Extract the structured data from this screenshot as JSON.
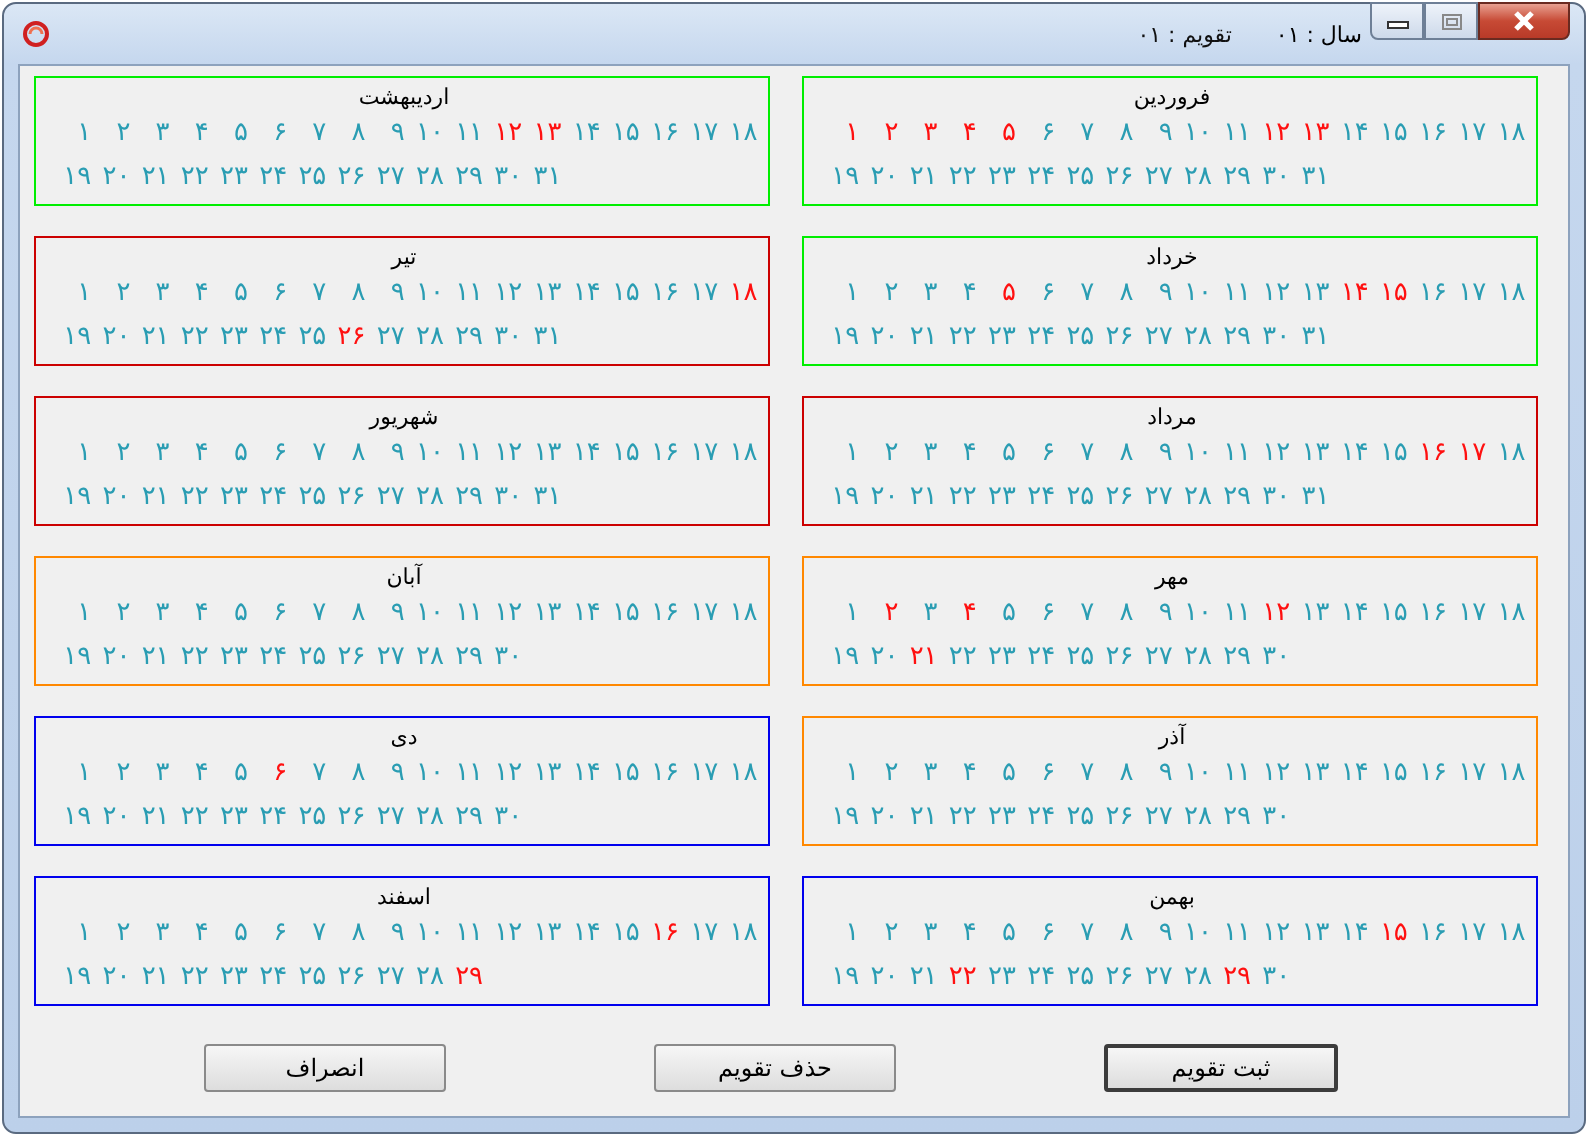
{
  "window": {
    "captions": [
      {
        "kind": "year",
        "text": "سال : ۰۱"
      },
      {
        "kind": "calendar",
        "text": "تقویم : ۰۱"
      }
    ]
  },
  "months": [
    {
      "name": "فروردین",
      "color": "#00ee00",
      "rows": [
        {
          "days": [
            {
              "d": "۱۸",
              "holiday": false
            },
            {
              "d": "۱۷",
              "holiday": false
            },
            {
              "d": "۱۶",
              "holiday": false
            },
            {
              "d": "۱۵",
              "holiday": false
            },
            {
              "d": "۱۴",
              "holiday": false
            },
            {
              "d": "۱۳",
              "holiday": true
            },
            {
              "d": "۱۲",
              "holiday": true
            },
            {
              "d": "۱۱",
              "holiday": false
            },
            {
              "d": "۱۰",
              "holiday": false
            },
            {
              "d": "۹",
              "holiday": false
            },
            {
              "d": "۸",
              "holiday": false
            },
            {
              "d": "۷",
              "holiday": false
            },
            {
              "d": "۶",
              "holiday": false
            },
            {
              "d": "۵",
              "holiday": true
            },
            {
              "d": "۴",
              "holiday": true
            },
            {
              "d": "۳",
              "holiday": true
            },
            {
              "d": "۲",
              "holiday": true
            },
            {
              "d": "۱",
              "holiday": true
            }
          ]
        },
        {
          "days": [
            {
              "d": "۳۱",
              "holiday": false
            },
            {
              "d": "۳۰",
              "holiday": false
            },
            {
              "d": "۲۹",
              "holiday": false
            },
            {
              "d": "۲۸",
              "holiday": false
            },
            {
              "d": "۲۷",
              "holiday": false
            },
            {
              "d": "۲۶",
              "holiday": false
            },
            {
              "d": "۲۵",
              "holiday": false
            },
            {
              "d": "۲۴",
              "holiday": false
            },
            {
              "d": "۲۳",
              "holiday": false
            },
            {
              "d": "۲۲",
              "holiday": false
            },
            {
              "d": "۲۱",
              "holiday": false
            },
            {
              "d": "۲۰",
              "holiday": false
            },
            {
              "d": "۱۹",
              "holiday": false
            }
          ]
        }
      ]
    },
    {
      "name": "اردیبهشت",
      "color": "#00ee00",
      "rows": [
        {
          "days": [
            {
              "d": "۱۸",
              "holiday": false
            },
            {
              "d": "۱۷",
              "holiday": false
            },
            {
              "d": "۱۶",
              "holiday": false
            },
            {
              "d": "۱۵",
              "holiday": false
            },
            {
              "d": "۱۴",
              "holiday": false
            },
            {
              "d": "۱۳",
              "holiday": true
            },
            {
              "d": "۱۲",
              "holiday": true
            },
            {
              "d": "۱۱",
              "holiday": false
            },
            {
              "d": "۱۰",
              "holiday": false
            },
            {
              "d": "۹",
              "holiday": false
            },
            {
              "d": "۸",
              "holiday": false
            },
            {
              "d": "۷",
              "holiday": false
            },
            {
              "d": "۶",
              "holiday": false
            },
            {
              "d": "۵",
              "holiday": false
            },
            {
              "d": "۴",
              "holiday": false
            },
            {
              "d": "۳",
              "holiday": false
            },
            {
              "d": "۲",
              "holiday": false
            },
            {
              "d": "۱",
              "holiday": false
            }
          ]
        },
        {
          "days": [
            {
              "d": "۳۱",
              "holiday": false
            },
            {
              "d": "۳۰",
              "holiday": false
            },
            {
              "d": "۲۹",
              "holiday": false
            },
            {
              "d": "۲۸",
              "holiday": false
            },
            {
              "d": "۲۷",
              "holiday": false
            },
            {
              "d": "۲۶",
              "holiday": false
            },
            {
              "d": "۲۵",
              "holiday": false
            },
            {
              "d": "۲۴",
              "holiday": false
            },
            {
              "d": "۲۳",
              "holiday": false
            },
            {
              "d": "۲۲",
              "holiday": false
            },
            {
              "d": "۲۱",
              "holiday": false
            },
            {
              "d": "۲۰",
              "holiday": false
            },
            {
              "d": "۱۹",
              "holiday": false
            }
          ]
        }
      ]
    },
    {
      "name": "خرداد",
      "color": "#00ee00",
      "rows": [
        {
          "days": [
            {
              "d": "۱۸",
              "holiday": false
            },
            {
              "d": "۱۷",
              "holiday": false
            },
            {
              "d": "۱۶",
              "holiday": false
            },
            {
              "d": "۱۵",
              "holiday": true
            },
            {
              "d": "۱۴",
              "holiday": true
            },
            {
              "d": "۱۳",
              "holiday": false
            },
            {
              "d": "۱۲",
              "holiday": false
            },
            {
              "d": "۱۱",
              "holiday": false
            },
            {
              "d": "۱۰",
              "holiday": false
            },
            {
              "d": "۹",
              "holiday": false
            },
            {
              "d": "۸",
              "holiday": false
            },
            {
              "d": "۷",
              "holiday": false
            },
            {
              "d": "۶",
              "holiday": false
            },
            {
              "d": "۵",
              "holiday": true
            },
            {
              "d": "۴",
              "holiday": false
            },
            {
              "d": "۳",
              "holiday": false
            },
            {
              "d": "۲",
              "holiday": false
            },
            {
              "d": "۱",
              "holiday": false
            }
          ]
        },
        {
          "days": [
            {
              "d": "۳۱",
              "holiday": false
            },
            {
              "d": "۳۰",
              "holiday": false
            },
            {
              "d": "۲۹",
              "holiday": false
            },
            {
              "d": "۲۸",
              "holiday": false
            },
            {
              "d": "۲۷",
              "holiday": false
            },
            {
              "d": "۲۶",
              "holiday": false
            },
            {
              "d": "۲۵",
              "holiday": false
            },
            {
              "d": "۲۴",
              "holiday": false
            },
            {
              "d": "۲۳",
              "holiday": false
            },
            {
              "d": "۲۲",
              "holiday": false
            },
            {
              "d": "۲۱",
              "holiday": false
            },
            {
              "d": "۲۰",
              "holiday": false
            },
            {
              "d": "۱۹",
              "holiday": false
            }
          ]
        }
      ]
    },
    {
      "name": "تیر",
      "color": "#cc0000",
      "rows": [
        {
          "days": [
            {
              "d": "۱۸",
              "holiday": true
            },
            {
              "d": "۱۷",
              "holiday": false
            },
            {
              "d": "۱۶",
              "holiday": false
            },
            {
              "d": "۱۵",
              "holiday": false
            },
            {
              "d": "۱۴",
              "holiday": false
            },
            {
              "d": "۱۳",
              "holiday": false
            },
            {
              "d": "۱۲",
              "holiday": false
            },
            {
              "d": "۱۱",
              "holiday": false
            },
            {
              "d": "۱۰",
              "holiday": false
            },
            {
              "d": "۹",
              "holiday": false
            },
            {
              "d": "۸",
              "holiday": false
            },
            {
              "d": "۷",
              "holiday": false
            },
            {
              "d": "۶",
              "holiday": false
            },
            {
              "d": "۵",
              "holiday": false
            },
            {
              "d": "۴",
              "holiday": false
            },
            {
              "d": "۳",
              "holiday": false
            },
            {
              "d": "۲",
              "holiday": false
            },
            {
              "d": "۱",
              "holiday": false
            }
          ]
        },
        {
          "days": [
            {
              "d": "۳۱",
              "holiday": false
            },
            {
              "d": "۳۰",
              "holiday": false
            },
            {
              "d": "۲۹",
              "holiday": false
            },
            {
              "d": "۲۸",
              "holiday": false
            },
            {
              "d": "۲۷",
              "holiday": false
            },
            {
              "d": "۲۶",
              "holiday": true
            },
            {
              "d": "۲۵",
              "holiday": false
            },
            {
              "d": "۲۴",
              "holiday": false
            },
            {
              "d": "۲۳",
              "holiday": false
            },
            {
              "d": "۲۲",
              "holiday": false
            },
            {
              "d": "۲۱",
              "holiday": false
            },
            {
              "d": "۲۰",
              "holiday": false
            },
            {
              "d": "۱۹",
              "holiday": false
            }
          ]
        }
      ]
    },
    {
      "name": "مرداد",
      "color": "#cc0000",
      "rows": [
        {
          "days": [
            {
              "d": "۱۸",
              "holiday": false
            },
            {
              "d": "۱۷",
              "holiday": true
            },
            {
              "d": "۱۶",
              "holiday": true
            },
            {
              "d": "۱۵",
              "holiday": false
            },
            {
              "d": "۱۴",
              "holiday": false
            },
            {
              "d": "۱۳",
              "holiday": false
            },
            {
              "d": "۱۲",
              "holiday": false
            },
            {
              "d": "۱۱",
              "holiday": false
            },
            {
              "d": "۱۰",
              "holiday": false
            },
            {
              "d": "۹",
              "holiday": false
            },
            {
              "d": "۸",
              "holiday": false
            },
            {
              "d": "۷",
              "holiday": false
            },
            {
              "d": "۶",
              "holiday": false
            },
            {
              "d": "۵",
              "holiday": false
            },
            {
              "d": "۴",
              "holiday": false
            },
            {
              "d": "۳",
              "holiday": false
            },
            {
              "d": "۲",
              "holiday": false
            },
            {
              "d": "۱",
              "holiday": false
            }
          ]
        },
        {
          "days": [
            {
              "d": "۳۱",
              "holiday": false
            },
            {
              "d": "۳۰",
              "holiday": false
            },
            {
              "d": "۲۹",
              "holiday": false
            },
            {
              "d": "۲۸",
              "holiday": false
            },
            {
              "d": "۲۷",
              "holiday": false
            },
            {
              "d": "۲۶",
              "holiday": false
            },
            {
              "d": "۲۵",
              "holiday": false
            },
            {
              "d": "۲۴",
              "holiday": false
            },
            {
              "d": "۲۳",
              "holiday": false
            },
            {
              "d": "۲۲",
              "holiday": false
            },
            {
              "d": "۲۱",
              "holiday": false
            },
            {
              "d": "۲۰",
              "holiday": false
            },
            {
              "d": "۱۹",
              "holiday": false
            }
          ]
        }
      ]
    },
    {
      "name": "شهریور",
      "color": "#cc0000",
      "rows": [
        {
          "days": [
            {
              "d": "۱۸",
              "holiday": false
            },
            {
              "d": "۱۷",
              "holiday": false
            },
            {
              "d": "۱۶",
              "holiday": false
            },
            {
              "d": "۱۵",
              "holiday": false
            },
            {
              "d": "۱۴",
              "holiday": false
            },
            {
              "d": "۱۳",
              "holiday": false
            },
            {
              "d": "۱۲",
              "holiday": false
            },
            {
              "d": "۱۱",
              "holiday": false
            },
            {
              "d": "۱۰",
              "holiday": false
            },
            {
              "d": "۹",
              "holiday": false
            },
            {
              "d": "۸",
              "holiday": false
            },
            {
              "d": "۷",
              "holiday": false
            },
            {
              "d": "۶",
              "holiday": false
            },
            {
              "d": "۵",
              "holiday": false
            },
            {
              "d": "۴",
              "holiday": false
            },
            {
              "d": "۳",
              "holiday": false
            },
            {
              "d": "۲",
              "holiday": false
            },
            {
              "d": "۱",
              "holiday": false
            }
          ]
        },
        {
          "days": [
            {
              "d": "۳۱",
              "holiday": false
            },
            {
              "d": "۳۰",
              "holiday": false
            },
            {
              "d": "۲۹",
              "holiday": false
            },
            {
              "d": "۲۸",
              "holiday": false
            },
            {
              "d": "۲۷",
              "holiday": false
            },
            {
              "d": "۲۶",
              "holiday": false
            },
            {
              "d": "۲۵",
              "holiday": false
            },
            {
              "d": "۲۴",
              "holiday": false
            },
            {
              "d": "۲۳",
              "holiday": false
            },
            {
              "d": "۲۲",
              "holiday": false
            },
            {
              "d": "۲۱",
              "holiday": false
            },
            {
              "d": "۲۰",
              "holiday": false
            },
            {
              "d": "۱۹",
              "holiday": false
            }
          ]
        }
      ]
    },
    {
      "name": "مهر",
      "color": "#ff8800",
      "rows": [
        {
          "days": [
            {
              "d": "۱۸",
              "holiday": false
            },
            {
              "d": "۱۷",
              "holiday": false
            },
            {
              "d": "۱۶",
              "holiday": false
            },
            {
              "d": "۱۵",
              "holiday": false
            },
            {
              "d": "۱۴",
              "holiday": false
            },
            {
              "d": "۱۳",
              "holiday": false
            },
            {
              "d": "۱۲",
              "holiday": true
            },
            {
              "d": "۱۱",
              "holiday": false
            },
            {
              "d": "۱۰",
              "holiday": false
            },
            {
              "d": "۹",
              "holiday": false
            },
            {
              "d": "۸",
              "holiday": false
            },
            {
              "d": "۷",
              "holiday": false
            },
            {
              "d": "۶",
              "holiday": false
            },
            {
              "d": "۵",
              "holiday": false
            },
            {
              "d": "۴",
              "holiday": true
            },
            {
              "d": "۳",
              "holiday": false
            },
            {
              "d": "۲",
              "holiday": true
            },
            {
              "d": "۱",
              "holiday": false
            }
          ]
        },
        {
          "days": [
            {
              "d": "۳۰",
              "holiday": false
            },
            {
              "d": "۲۹",
              "holiday": false
            },
            {
              "d": "۲۸",
              "holiday": false
            },
            {
              "d": "۲۷",
              "holiday": false
            },
            {
              "d": "۲۶",
              "holiday": false
            },
            {
              "d": "۲۵",
              "holiday": false
            },
            {
              "d": "۲۴",
              "holiday": false
            },
            {
              "d": "۲۳",
              "holiday": false
            },
            {
              "d": "۲۲",
              "holiday": false
            },
            {
              "d": "۲۱",
              "holiday": true
            },
            {
              "d": "۲۰",
              "holiday": false
            },
            {
              "d": "۱۹",
              "holiday": false
            }
          ]
        }
      ]
    },
    {
      "name": "آبان",
      "color": "#ff8800",
      "rows": [
        {
          "days": [
            {
              "d": "۱۸",
              "holiday": false
            },
            {
              "d": "۱۷",
              "holiday": false
            },
            {
              "d": "۱۶",
              "holiday": false
            },
            {
              "d": "۱۵",
              "holiday": false
            },
            {
              "d": "۱۴",
              "holiday": false
            },
            {
              "d": "۱۳",
              "holiday": false
            },
            {
              "d": "۱۲",
              "holiday": false
            },
            {
              "d": "۱۱",
              "holiday": false
            },
            {
              "d": "۱۰",
              "holiday": false
            },
            {
              "d": "۹",
              "holiday": false
            },
            {
              "d": "۸",
              "holiday": false
            },
            {
              "d": "۷",
              "holiday": false
            },
            {
              "d": "۶",
              "holiday": false
            },
            {
              "d": "۵",
              "holiday": false
            },
            {
              "d": "۴",
              "holiday": false
            },
            {
              "d": "۳",
              "holiday": false
            },
            {
              "d": "۲",
              "holiday": false
            },
            {
              "d": "۱",
              "holiday": false
            }
          ]
        },
        {
          "days": [
            {
              "d": "۳۰",
              "holiday": false
            },
            {
              "d": "۲۹",
              "holiday": false
            },
            {
              "d": "۲۸",
              "holiday": false
            },
            {
              "d": "۲۷",
              "holiday": false
            },
            {
              "d": "۲۶",
              "holiday": false
            },
            {
              "d": "۲۵",
              "holiday": false
            },
            {
              "d": "۲۴",
              "holiday": false
            },
            {
              "d": "۲۳",
              "holiday": false
            },
            {
              "d": "۲۲",
              "holiday": false
            },
            {
              "d": "۲۱",
              "holiday": false
            },
            {
              "d": "۲۰",
              "holiday": false
            },
            {
              "d": "۱۹",
              "holiday": false
            }
          ]
        }
      ]
    },
    {
      "name": "آذر",
      "color": "#ff8800",
      "rows": [
        {
          "days": [
            {
              "d": "۱۸",
              "holiday": false
            },
            {
              "d": "۱۷",
              "holiday": false
            },
            {
              "d": "۱۶",
              "holiday": false
            },
            {
              "d": "۱۵",
              "holiday": false
            },
            {
              "d": "۱۴",
              "holiday": false
            },
            {
              "d": "۱۳",
              "holiday": false
            },
            {
              "d": "۱۲",
              "holiday": false
            },
            {
              "d": "۱۱",
              "holiday": false
            },
            {
              "d": "۱۰",
              "holiday": false
            },
            {
              "d": "۹",
              "holiday": false
            },
            {
              "d": "۸",
              "holiday": false
            },
            {
              "d": "۷",
              "holiday": false
            },
            {
              "d": "۶",
              "holiday": false
            },
            {
              "d": "۵",
              "holiday": false
            },
            {
              "d": "۴",
              "holiday": false
            },
            {
              "d": "۳",
              "holiday": false
            },
            {
              "d": "۲",
              "holiday": false
            },
            {
              "d": "۱",
              "holiday": false
            }
          ]
        },
        {
          "days": [
            {
              "d": "۳۰",
              "holiday": false
            },
            {
              "d": "۲۹",
              "holiday": false
            },
            {
              "d": "۲۸",
              "holiday": false
            },
            {
              "d": "۲۷",
              "holiday": false
            },
            {
              "d": "۲۶",
              "holiday": false
            },
            {
              "d": "۲۵",
              "holiday": false
            },
            {
              "d": "۲۴",
              "holiday": false
            },
            {
              "d": "۲۳",
              "holiday": false
            },
            {
              "d": "۲۲",
              "holiday": false
            },
            {
              "d": "۲۱",
              "holiday": false
            },
            {
              "d": "۲۰",
              "holiday": false
            },
            {
              "d": "۱۹",
              "holiday": false
            }
          ]
        }
      ]
    },
    {
      "name": "دی",
      "color": "#0000ee",
      "rows": [
        {
          "days": [
            {
              "d": "۱۸",
              "holiday": false
            },
            {
              "d": "۱۷",
              "holiday": false
            },
            {
              "d": "۱۶",
              "holiday": false
            },
            {
              "d": "۱۵",
              "holiday": false
            },
            {
              "d": "۱۴",
              "holiday": false
            },
            {
              "d": "۱۳",
              "holiday": false
            },
            {
              "d": "۱۲",
              "holiday": false
            },
            {
              "d": "۱۱",
              "holiday": false
            },
            {
              "d": "۱۰",
              "holiday": false
            },
            {
              "d": "۹",
              "holiday": false
            },
            {
              "d": "۸",
              "holiday": false
            },
            {
              "d": "۷",
              "holiday": false
            },
            {
              "d": "۶",
              "holiday": true
            },
            {
              "d": "۵",
              "holiday": false
            },
            {
              "d": "۴",
              "holiday": false
            },
            {
              "d": "۳",
              "holiday": false
            },
            {
              "d": "۲",
              "holiday": false
            },
            {
              "d": "۱",
              "holiday": false
            }
          ]
        },
        {
          "days": [
            {
              "d": "۳۰",
              "holiday": false
            },
            {
              "d": "۲۹",
              "holiday": false
            },
            {
              "d": "۲۸",
              "holiday": false
            },
            {
              "d": "۲۷",
              "holiday": false
            },
            {
              "d": "۲۶",
              "holiday": false
            },
            {
              "d": "۲۵",
              "holiday": false
            },
            {
              "d": "۲۴",
              "holiday": false
            },
            {
              "d": "۲۳",
              "holiday": false
            },
            {
              "d": "۲۲",
              "holiday": false
            },
            {
              "d": "۲۱",
              "holiday": false
            },
            {
              "d": "۲۰",
              "holiday": false
            },
            {
              "d": "۱۹",
              "holiday": false
            }
          ]
        }
      ]
    },
    {
      "name": "بهمن",
      "color": "#0000ee",
      "rows": [
        {
          "days": [
            {
              "d": "۱۸",
              "holiday": false
            },
            {
              "d": "۱۷",
              "holiday": false
            },
            {
              "d": "۱۶",
              "holiday": false
            },
            {
              "d": "۱۵",
              "holiday": true
            },
            {
              "d": "۱۴",
              "holiday": false
            },
            {
              "d": "۱۳",
              "holiday": false
            },
            {
              "d": "۱۲",
              "holiday": false
            },
            {
              "d": "۱۱",
              "holiday": false
            },
            {
              "d": "۱۰",
              "holiday": false
            },
            {
              "d": "۹",
              "holiday": false
            },
            {
              "d": "۸",
              "holiday": false
            },
            {
              "d": "۷",
              "holiday": false
            },
            {
              "d": "۶",
              "holiday": false
            },
            {
              "d": "۵",
              "holiday": false
            },
            {
              "d": "۴",
              "holiday": false
            },
            {
              "d": "۳",
              "holiday": false
            },
            {
              "d": "۲",
              "holiday": false
            },
            {
              "d": "۱",
              "holiday": false
            }
          ]
        },
        {
          "days": [
            {
              "d": "۳۰",
              "holiday": false
            },
            {
              "d": "۲۹",
              "holiday": true
            },
            {
              "d": "۲۸",
              "holiday": false
            },
            {
              "d": "۲۷",
              "holiday": false
            },
            {
              "d": "۲۶",
              "holiday": false
            },
            {
              "d": "۲۵",
              "holiday": false
            },
            {
              "d": "۲۴",
              "holiday": false
            },
            {
              "d": "۲۳",
              "holiday": false
            },
            {
              "d": "۲۲",
              "holiday": true
            },
            {
              "d": "۲۱",
              "holiday": false
            },
            {
              "d": "۲۰",
              "holiday": false
            },
            {
              "d": "۱۹",
              "holiday": false
            }
          ]
        }
      ]
    },
    {
      "name": "اسفند",
      "color": "#0000ee",
      "rows": [
        {
          "days": [
            {
              "d": "۱۸",
              "holiday": false
            },
            {
              "d": "۱۷",
              "holiday": false
            },
            {
              "d": "۱۶",
              "holiday": true
            },
            {
              "d": "۱۵",
              "holiday": false
            },
            {
              "d": "۱۴",
              "holiday": false
            },
            {
              "d": "۱۳",
              "holiday": false
            },
            {
              "d": "۱۲",
              "holiday": false
            },
            {
              "d": "۱۱",
              "holiday": false
            },
            {
              "d": "۱۰",
              "holiday": false
            },
            {
              "d": "۹",
              "holiday": false
            },
            {
              "d": "۸",
              "holiday": false
            },
            {
              "d": "۷",
              "holiday": false
            },
            {
              "d": "۶",
              "holiday": false
            },
            {
              "d": "۵",
              "holiday": false
            },
            {
              "d": "۴",
              "holiday": false
            },
            {
              "d": "۳",
              "holiday": false
            },
            {
              "d": "۲",
              "holiday": false
            },
            {
              "d": "۱",
              "holiday": false
            }
          ]
        },
        {
          "days": [
            {
              "d": "۲۹",
              "holiday": true
            },
            {
              "d": "۲۸",
              "holiday": false
            },
            {
              "d": "۲۷",
              "holiday": false
            },
            {
              "d": "۲۶",
              "holiday": false
            },
            {
              "d": "۲۵",
              "holiday": false
            },
            {
              "d": "۲۴",
              "holiday": false
            },
            {
              "d": "۲۳",
              "holiday": false
            },
            {
              "d": "۲۲",
              "holiday": false
            },
            {
              "d": "۲۱",
              "holiday": false
            },
            {
              "d": "۲۰",
              "holiday": false
            },
            {
              "d": "۱۹",
              "holiday": false
            }
          ]
        }
      ]
    }
  ],
  "buttons": [
    {
      "label": "ثبت تقویم",
      "default": true
    },
    {
      "label": "حذف تقویم",
      "default": false
    },
    {
      "label": "انصراف",
      "default": false
    }
  ]
}
